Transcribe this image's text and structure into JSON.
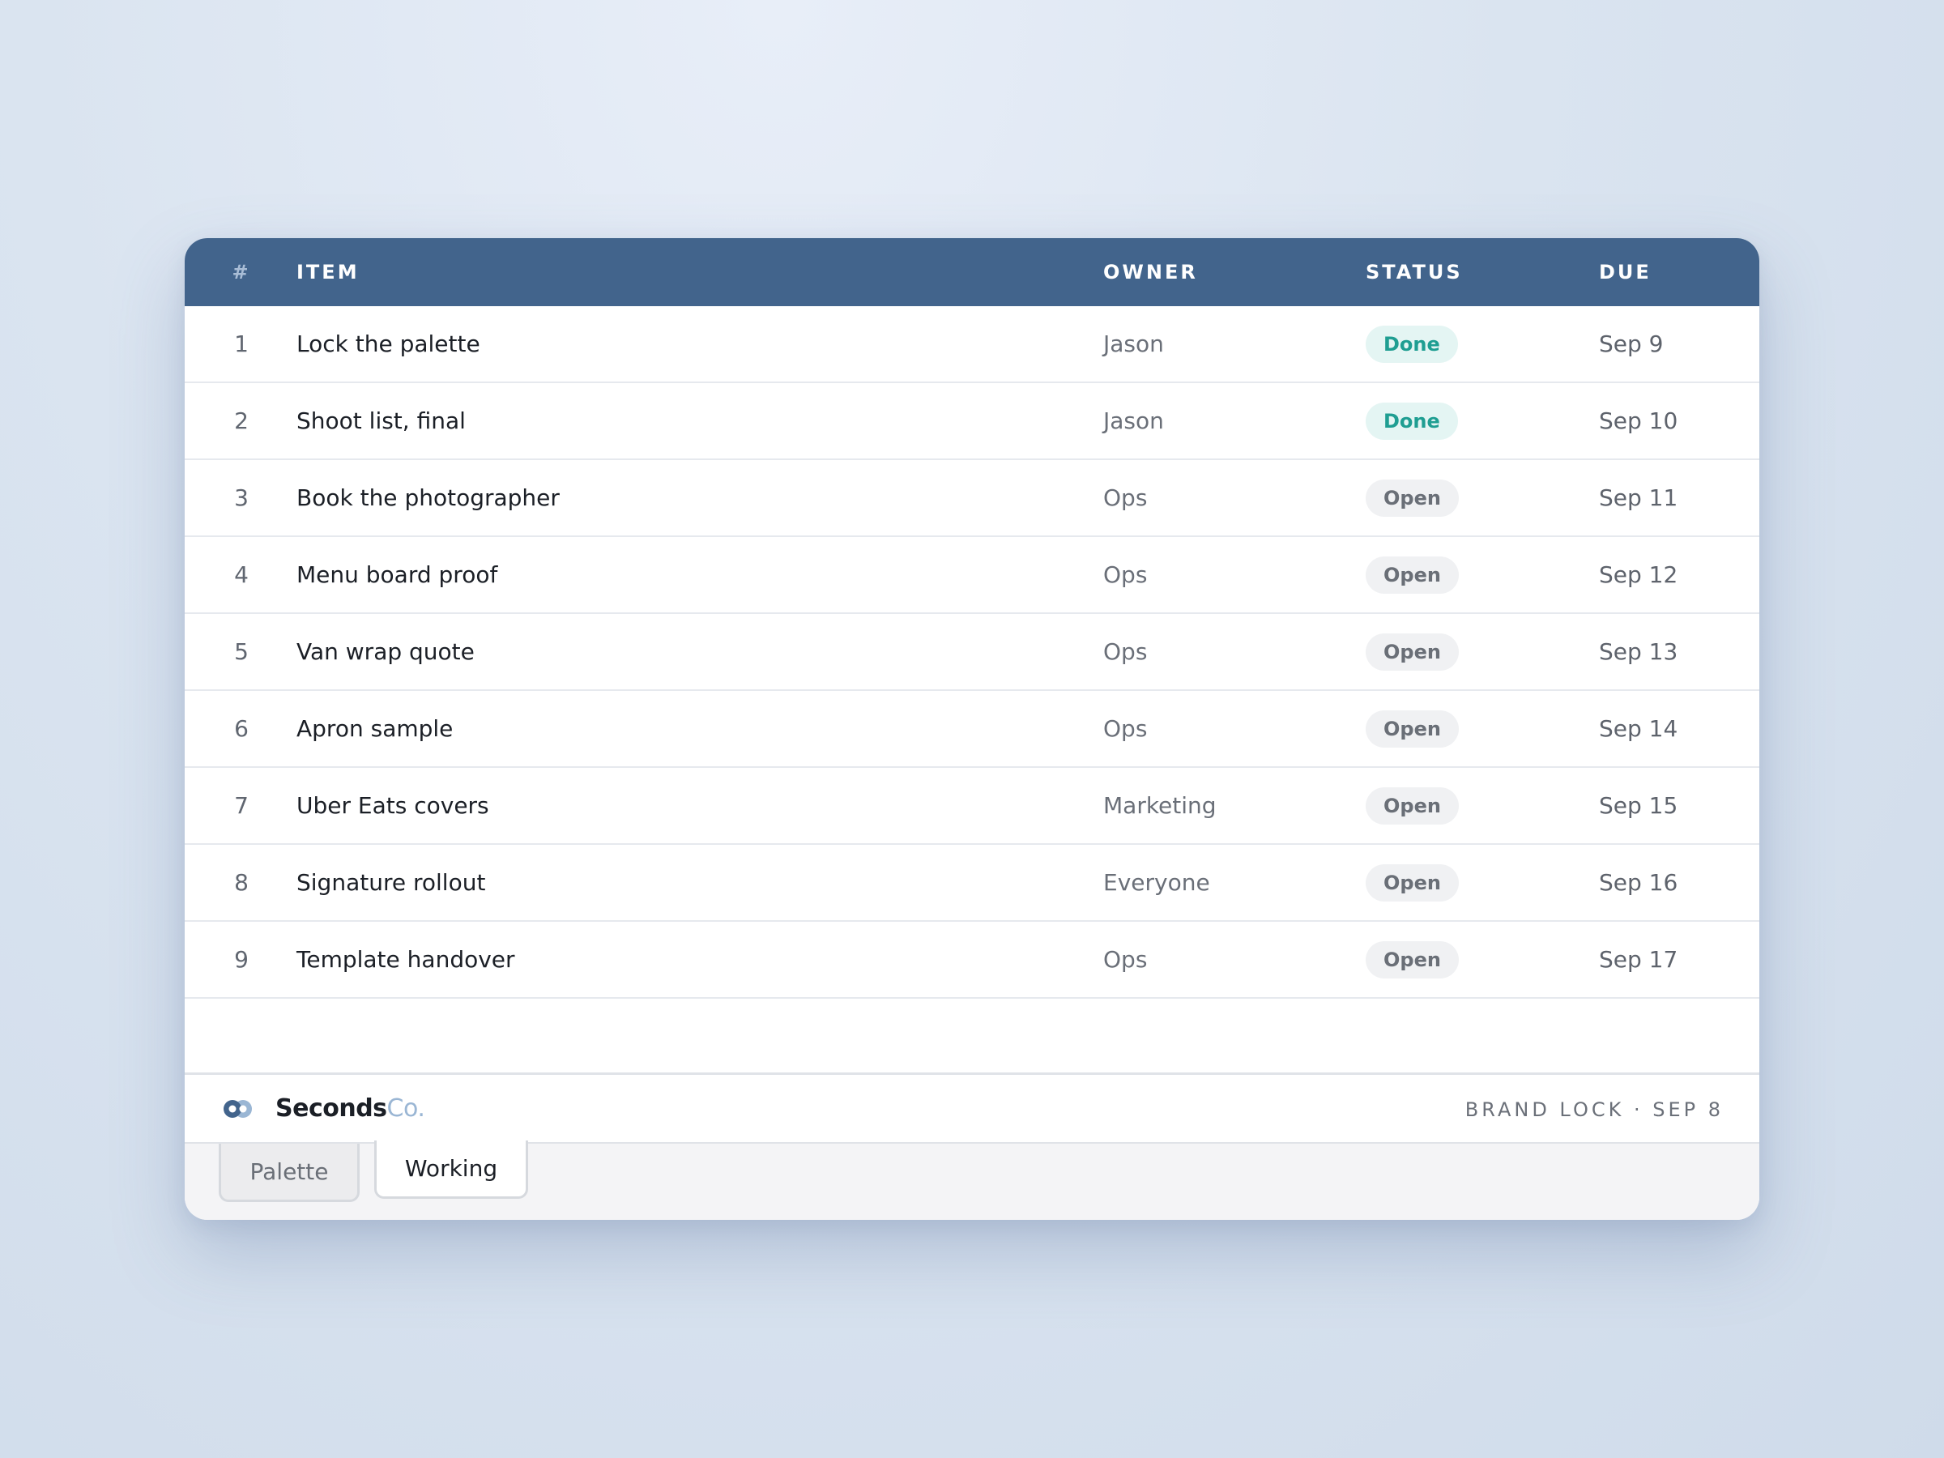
{
  "table": {
    "headers": {
      "num": "#",
      "item": "ITEM",
      "owner": "OWNER",
      "status": "STATUS",
      "due": "DUE"
    },
    "rows": [
      {
        "num": "1",
        "item": "Lock the palette",
        "owner": "Jason",
        "status": "Done",
        "due": "Sep 9"
      },
      {
        "num": "2",
        "item": "Shoot list, final",
        "owner": "Jason",
        "status": "Done",
        "due": "Sep 10"
      },
      {
        "num": "3",
        "item": "Book the photographer",
        "owner": "Ops",
        "status": "Open",
        "due": "Sep 11"
      },
      {
        "num": "4",
        "item": "Menu board proof",
        "owner": "Ops",
        "status": "Open",
        "due": "Sep 12"
      },
      {
        "num": "5",
        "item": "Van wrap quote",
        "owner": "Ops",
        "status": "Open",
        "due": "Sep 13"
      },
      {
        "num": "6",
        "item": "Apron sample",
        "owner": "Ops",
        "status": "Open",
        "due": "Sep 14"
      },
      {
        "num": "7",
        "item": "Uber Eats covers",
        "owner": "Marketing",
        "status": "Open",
        "due": "Sep 15"
      },
      {
        "num": "8",
        "item": "Signature rollout",
        "owner": "Everyone",
        "status": "Open",
        "due": "Sep 16"
      },
      {
        "num": "9",
        "item": "Template handover",
        "owner": "Ops",
        "status": "Open",
        "due": "Sep 17"
      }
    ]
  },
  "footer": {
    "brand_primary": "Seconds",
    "brand_secondary": "Co.",
    "meta": "BRAND LOCK · SEP 8",
    "logo_icon": "two-circles-logo-icon"
  },
  "tabs": [
    {
      "label": "Palette",
      "active": false
    },
    {
      "label": "Working",
      "active": true
    }
  ],
  "colors": {
    "header_bg": "#42648c",
    "done_text": "#1f9e92",
    "done_bg": "#e4f5f3",
    "open_text": "#6a6f77",
    "open_bg": "#f0f1f3",
    "brand_accent": "#9ab6d4"
  }
}
